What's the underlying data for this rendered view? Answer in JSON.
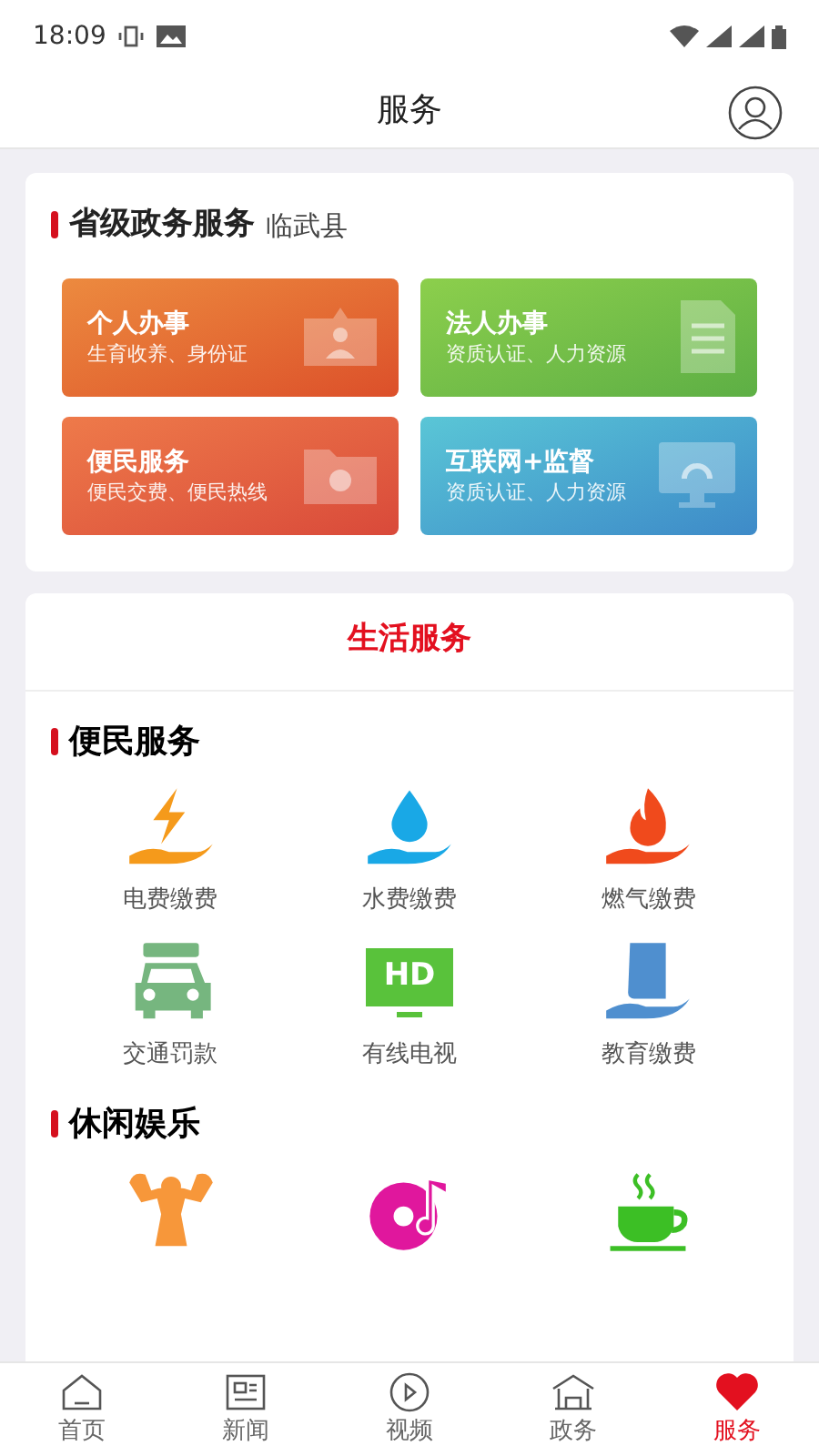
{
  "status_bar": {
    "time": "18:09"
  },
  "header": {
    "title": "服务"
  },
  "province": {
    "title": "省级政务服务",
    "region": "临武县",
    "tiles": [
      {
        "kind": "person",
        "title": "个人办事",
        "desc": "生育收养、身份证"
      },
      {
        "kind": "document",
        "title": "法人办事",
        "desc": "资质认证、人力资源"
      },
      {
        "kind": "folder",
        "title": "便民服务",
        "desc": "便民交费、便民热线"
      },
      {
        "kind": "monitor",
        "title": "互联网+监督",
        "desc": "资质认证、人力资源"
      }
    ]
  },
  "life": {
    "title": "生活服务",
    "sections": [
      {
        "title": "便民服务",
        "items": [
          {
            "kind": "electricity",
            "label": "电费缴费"
          },
          {
            "kind": "water",
            "label": "水费缴费"
          },
          {
            "kind": "gas",
            "label": "燃气缴费"
          },
          {
            "kind": "car",
            "label": "交通罚款"
          },
          {
            "kind": "tv",
            "label": "有线电视",
            "badge": "HD"
          },
          {
            "kind": "book",
            "label": "教育缴费"
          }
        ]
      },
      {
        "title": "休闲娱乐",
        "items": [
          {
            "kind": "fitness"
          },
          {
            "kind": "music"
          },
          {
            "kind": "tea"
          }
        ]
      }
    ]
  },
  "tab_bar": [
    {
      "kind": "home",
      "label": "首页",
      "selected": false
    },
    {
      "kind": "news",
      "label": "新闻",
      "selected": false
    },
    {
      "kind": "video",
      "label": "视频",
      "selected": false
    },
    {
      "kind": "gov",
      "label": "政务",
      "selected": false
    },
    {
      "kind": "heart",
      "label": "服务",
      "selected": true
    }
  ]
}
